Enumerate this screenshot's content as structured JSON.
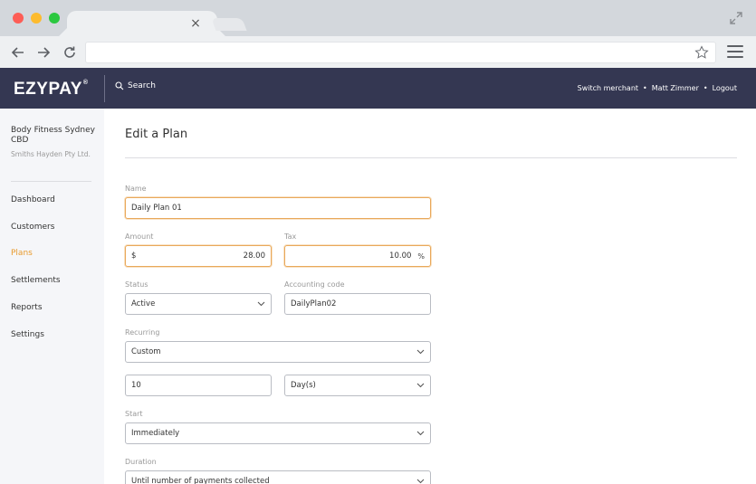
{
  "app": {
    "logo": "EZYPAY",
    "logo_mark": "®",
    "search_label": "Search",
    "header_links": [
      "Switch merchant",
      "Matt Zimmer",
      "Logout"
    ],
    "header_separator": "•"
  },
  "browser": {
    "tab_close": "×",
    "url": ""
  },
  "sidebar": {
    "merchant_name": "Body Fitness Sydney CBD",
    "merchant_company": "Smiths Hayden Pty Ltd.",
    "items": [
      {
        "label": "Dashboard",
        "active": false
      },
      {
        "label": "Customers",
        "active": false
      },
      {
        "label": "Plans",
        "active": true
      },
      {
        "label": "Settlements",
        "active": false
      },
      {
        "label": "Reports",
        "active": false
      },
      {
        "label": "Settings",
        "active": false
      }
    ]
  },
  "form": {
    "title": "Edit a Plan",
    "name_label": "Name",
    "name_value": "Daily Plan 01",
    "amount_label": "Amount",
    "amount_currency": "$",
    "amount_value": "28.00",
    "tax_label": "Tax",
    "tax_value": "10.00",
    "tax_suffix": "%",
    "status_label": "Status",
    "status_value": "Active",
    "accounting_label": "Accounting code",
    "accounting_value": "DailyPlan02",
    "recurring_label": "Recurring",
    "recurring_value": "Custom",
    "interval_value": "10",
    "interval_unit": "Day(s)",
    "start_label": "Start",
    "start_value": "Immediately",
    "duration_label": "Duration",
    "duration_value": "Until number of payments collected"
  },
  "colors": {
    "header_bg": "#343752",
    "accent": "#e89a2c",
    "focus_border": "#e9a85a"
  }
}
